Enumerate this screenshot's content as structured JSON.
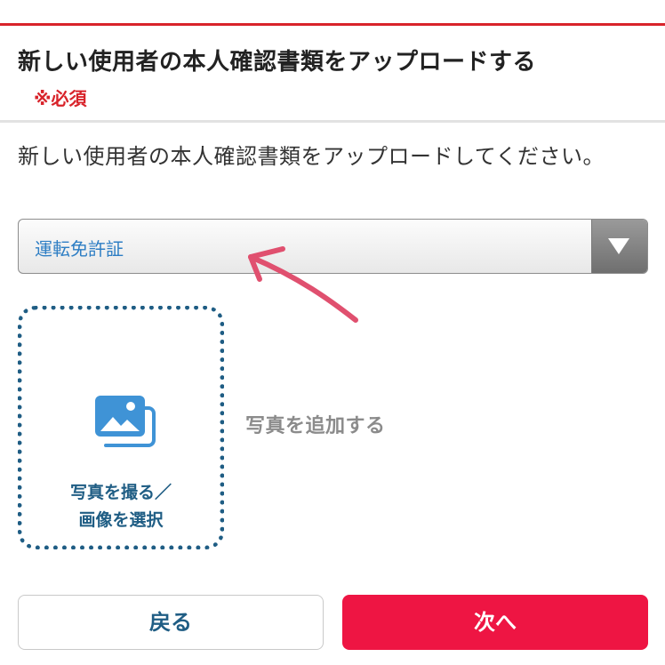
{
  "header": {
    "title": "新しい使用者の本人確認書類をアップロードする",
    "required_label": "※必須",
    "accent_color": "#d8232a"
  },
  "instruction": "新しい使用者の本人確認書類をアップロードしてください。",
  "document_select": {
    "selected_value": "運転免許証",
    "arrow_icon": "triangle-down-icon"
  },
  "upload": {
    "icon": "image-gallery-icon",
    "box_label_line1": "写真を撮る／",
    "box_label_line2": "画像を選択",
    "side_label": "写真を追加する"
  },
  "annotation": {
    "arrow_color": "#e0506f",
    "icon": "hand-drawn-arrow"
  },
  "footer": {
    "back_label": "戻る",
    "next_label": "次へ",
    "next_color": "#ee1543"
  }
}
